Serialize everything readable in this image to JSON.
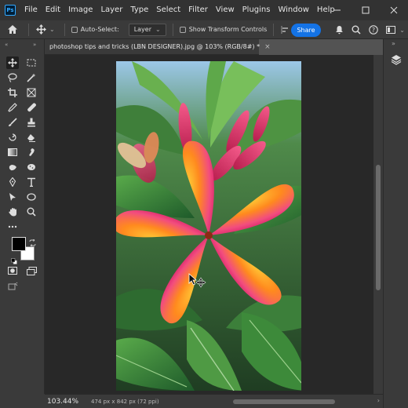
{
  "app": {
    "logo_text": "Ps"
  },
  "menu": [
    "File",
    "Edit",
    "Image",
    "Layer",
    "Type",
    "Select",
    "Filter",
    "View",
    "Plugins",
    "Window",
    "Help"
  ],
  "options_bar": {
    "auto_select_label": "Auto-Select:",
    "layer_dropdown": "Layer",
    "show_transform_label": "Show Transform Controls",
    "share_label": "Share"
  },
  "document": {
    "tab_title": "photoshop tips and tricks (LBN DESIGNER).jpg @ 103% (RGB/8#) *",
    "close_glyph": "×"
  },
  "status": {
    "zoom": "103.44%",
    "doc_info": "474 px x 842 px (72 ppi)"
  },
  "icons": {
    "window_controls": [
      "minimize-icon",
      "maximize-icon",
      "close-icon"
    ],
    "tools": [
      "move-icon",
      "marquee-icon",
      "lasso-icon",
      "magic-wand-icon",
      "crop-icon",
      "frame-icon",
      "eyedropper-icon",
      "healing-icon",
      "brush-icon",
      "stamp-icon",
      "history-brush-icon",
      "eraser-icon",
      "gradient-icon",
      "smudge-icon",
      "dodge-icon",
      "pen-icon",
      "type-icon",
      "path-select-icon",
      "shape-icon",
      "hand-icon",
      "zoom-icon",
      "more-icon"
    ]
  },
  "colors": {
    "foreground": "#000000",
    "background": "#ffffff",
    "accent": "#1473e6"
  }
}
